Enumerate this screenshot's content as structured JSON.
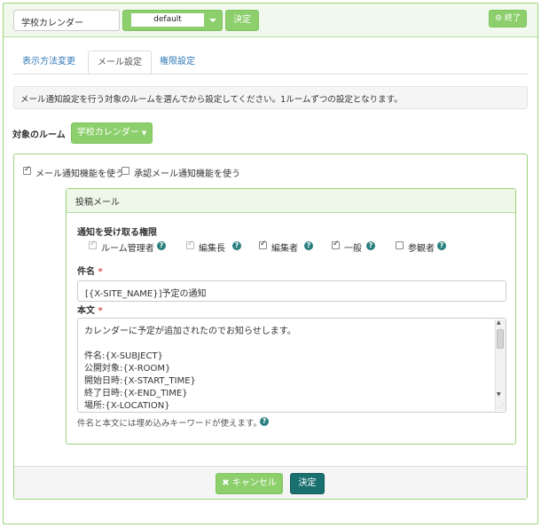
{
  "header": {
    "frame_title_value": "学校カレンダー",
    "select_value": "default",
    "decide_label": "決定",
    "finish_label": "終了",
    "finish_icon": "gear-icon"
  },
  "tabs": [
    {
      "label": "表示方法変更",
      "active": false
    },
    {
      "label": "メール設定",
      "active": true
    },
    {
      "label": "権限設定",
      "active": false
    }
  ],
  "notice": "メール通知設定を行う対象のルームを選んでから設定してください。1ルームずつの設定となります。",
  "room": {
    "label": "対象のルーム",
    "button_label": "学校カレンダー"
  },
  "options": {
    "mail_notify_label": "メール通知機能を使う",
    "mail_notify_checked": true,
    "approval_notify_label": "承認メール通知機能を使う",
    "approval_notify_checked": false
  },
  "post_mail": {
    "title": "投稿メール",
    "roles_heading": "通知を受け取る権限",
    "roles": [
      {
        "label": "ルーム管理者",
        "checked": true,
        "disabled": true
      },
      {
        "label": "編集長",
        "checked": true,
        "disabled": true
      },
      {
        "label": "編集者",
        "checked": true,
        "disabled": false
      },
      {
        "label": "一般",
        "checked": true,
        "disabled": false
      },
      {
        "label": "参観者",
        "checked": false,
        "disabled": false
      }
    ],
    "subject_label": "件名",
    "subject_value": "[{X-SITE_NAME}]予定の通知",
    "body_label": "本文",
    "body_lines": [
      "カレンダーに予定が追加されたのでお知らせします。",
      "",
      "件名:{X-SUBJECT}",
      "公開対象:{X-ROOM}",
      "開始日時:{X-START_TIME}",
      "終了日時:{X-END_TIME}",
      "場所:{X-LOCATION}"
    ],
    "hint": "件名と本文には埋め込みキーワードが使えます。",
    "required_mark": "*",
    "help_mark": "?"
  },
  "footer": {
    "cancel_label": "キャンセル",
    "cancel_icon": "close-icon",
    "decide_label": "決定"
  },
  "colors": {
    "accent_green": "#8ccf6c",
    "primary_teal": "#1a6f6f",
    "help_teal": "#2a7f7f",
    "required_red": "#d9534f",
    "link_blue": "#337ab7"
  }
}
